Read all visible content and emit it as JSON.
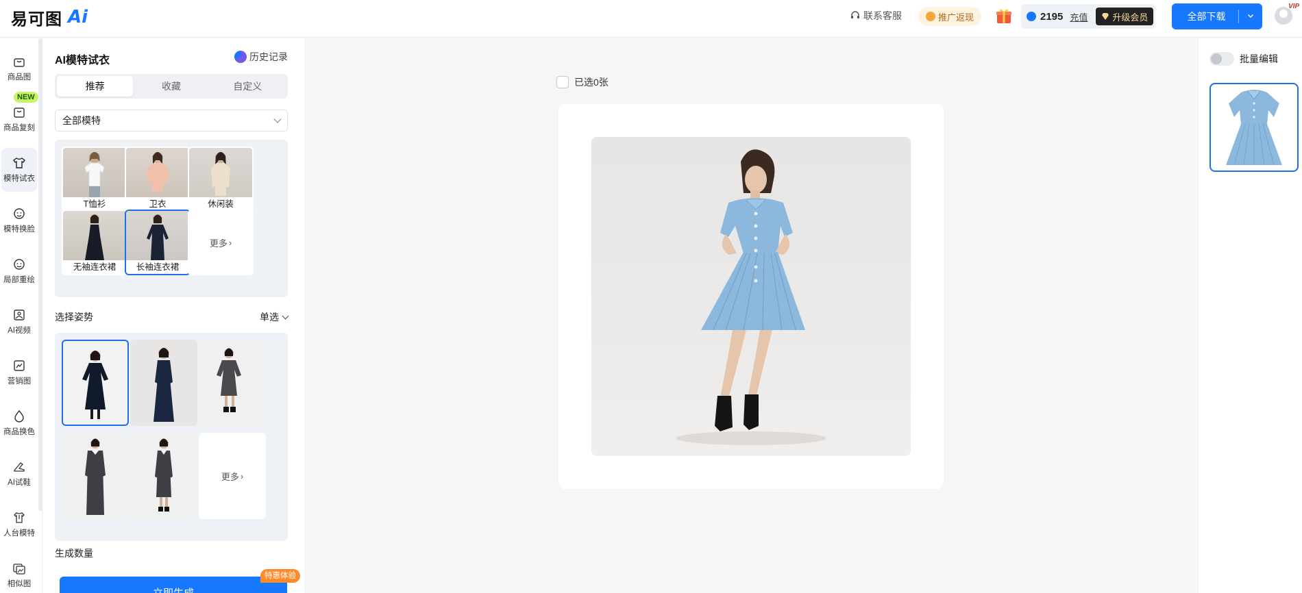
{
  "brand": {
    "logo_text": "易可图",
    "logo_ai": "Ai"
  },
  "header": {
    "service_label": "联系客服",
    "promo_label": "推广返现",
    "balance": "2195",
    "recharge_label": "充值",
    "vip_label": "升级会员",
    "download_label": "全部下载",
    "vip_corner": "VIP"
  },
  "leftnav": {
    "new_badge": "NEW",
    "items": [
      {
        "label": "商品图",
        "icon": "bag-icon"
      },
      {
        "label": "商品复刻",
        "icon": "copy-bag-icon"
      },
      {
        "label": "模特试衣",
        "icon": "shirt-icon"
      },
      {
        "label": "模特换脸",
        "icon": "face-icon"
      },
      {
        "label": "局部重绘",
        "icon": "face-repaint-icon"
      },
      {
        "label": "AI视频",
        "icon": "video-icon"
      },
      {
        "label": "营销图",
        "icon": "marketing-icon"
      },
      {
        "label": "商品换色",
        "icon": "color-drop-icon"
      },
      {
        "label": "AI试鞋",
        "icon": "shoe-icon"
      },
      {
        "label": "人台模特",
        "icon": "mannequin-icon"
      },
      {
        "label": "相似图",
        "icon": "similar-image-icon"
      }
    ]
  },
  "panel": {
    "title": "AI模特试衣",
    "history_label": "历史记录",
    "tabs": [
      "推荐",
      "收藏",
      "自定义"
    ],
    "model_select": "全部模特",
    "clothing": [
      {
        "label": "T恤衫"
      },
      {
        "label": "卫衣"
      },
      {
        "label": "休闲装"
      },
      {
        "label": "无袖连衣裙"
      },
      {
        "label": "长袖连衣裙"
      }
    ],
    "more_label": "更多",
    "pose_title": "选择姿势",
    "pose_mode": "单选",
    "pose_more_label": "更多",
    "quantity_label": "生成数量",
    "generate_label": "立即生成",
    "special_badge": "特惠体验"
  },
  "canvas": {
    "selected_count_label": "已选0张"
  },
  "rightpanel": {
    "batch_edit_label": "批量编辑"
  },
  "colors": {
    "accent": "#1677ff",
    "selected_border": "#1f6fea",
    "dress_blue": "#8db8dd",
    "badge_orange": "#ff8a2b"
  }
}
